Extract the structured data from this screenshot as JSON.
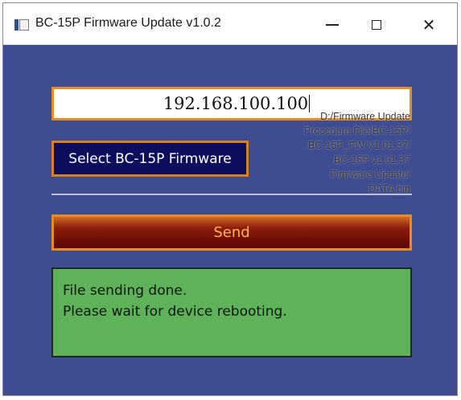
{
  "window": {
    "title": "BC-15P Firmware Update v1.0.2",
    "controls": {
      "minimize": "minimize-icon",
      "maximize": "maximize-icon",
      "close": "close-icon"
    }
  },
  "form": {
    "ip_address": "192.168.100.100",
    "file_path_lines": [
      "D:/Firmware Update",
      "Procedure File/BC-15P/",
      "BC-15P_FW V1.01.37/",
      "BC-15P v1.01.37",
      "Firmware Update/",
      "DATA.bin"
    ],
    "select_button_label": "Select BC-15P Firmware",
    "send_button_label": "Send"
  },
  "status": {
    "lines": [
      "File sending done.",
      "Please wait for device rebooting."
    ]
  },
  "colors": {
    "background": "#3f4c91",
    "accent_border": "#e58d22",
    "select_button_bg": "#0d0d5e",
    "send_button_bg": "#5a0603",
    "send_button_text": "#ffb457",
    "status_bg": "#5fb15a"
  }
}
